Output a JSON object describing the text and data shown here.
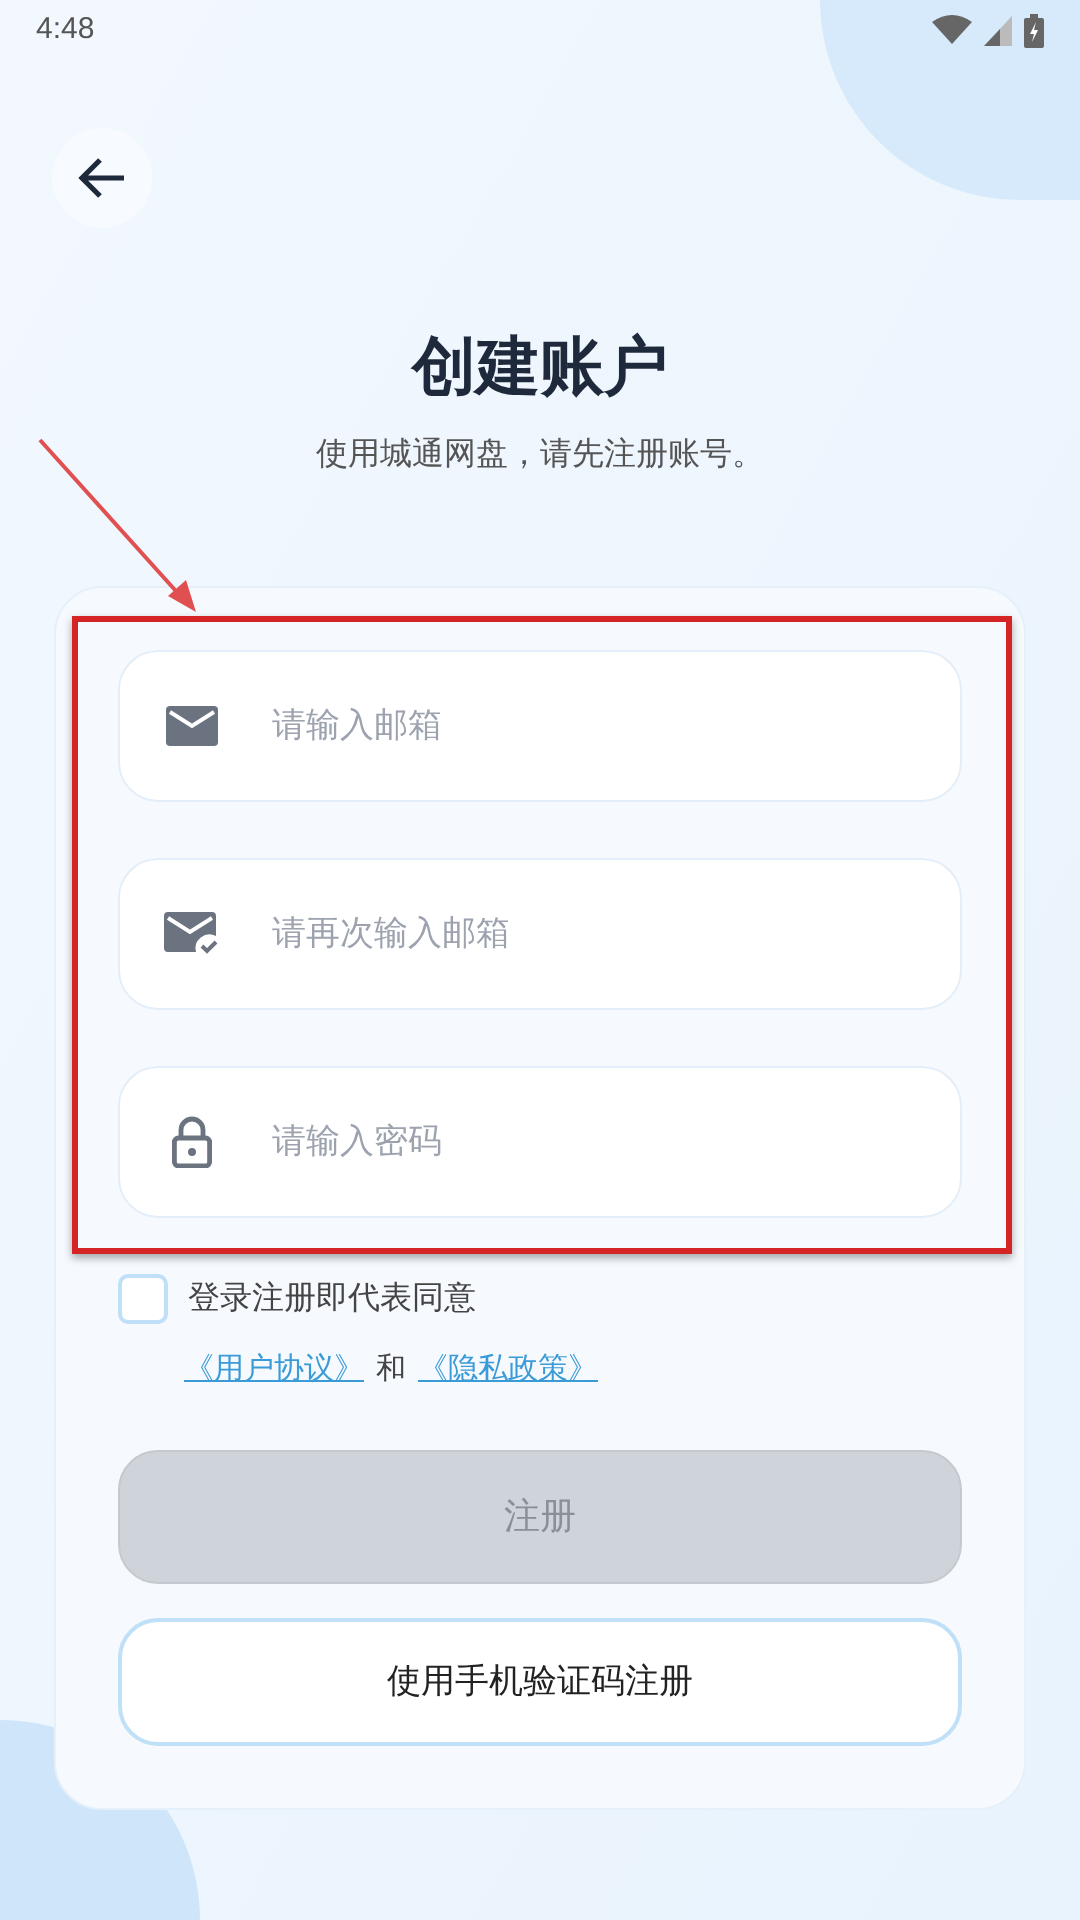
{
  "status_bar": {
    "time": "4:48"
  },
  "title": "创建账户",
  "subtitle": "使用城通网盘，请先注册账号。",
  "fields": [
    {
      "kind": "email",
      "placeholder": "请输入邮箱"
    },
    {
      "kind": "email_confirm",
      "placeholder": "请再次输入邮箱"
    },
    {
      "kind": "password",
      "placeholder": "请输入密码"
    }
  ],
  "agreement": {
    "checked": false,
    "text": "登录注册即代表同意",
    "links": [
      "《用户协议》",
      "《隐私政策》"
    ],
    "joiner": "和"
  },
  "buttons": [
    {
      "kind": "primary",
      "label": "注册",
      "disabled": true
    },
    {
      "kind": "outline",
      "label": "使用手机验证码注册",
      "disabled": false
    }
  ]
}
